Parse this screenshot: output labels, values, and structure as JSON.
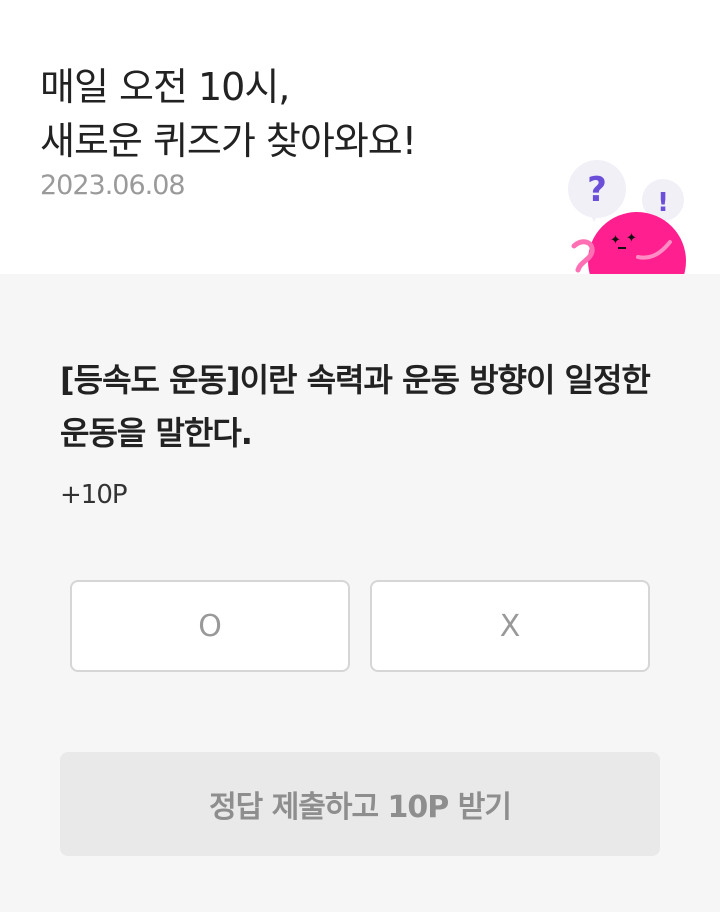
{
  "header": {
    "title_line1": "매일 오전 10시,",
    "title_line2": "새로운 퀴즈가 찾아와요!",
    "date": "2023.06.08"
  },
  "mascot": {
    "question_mark": "?",
    "exclamation_mark": "!",
    "body_color": "#ff1f8e",
    "bubble_color": "#f1f0f7"
  },
  "quiz": {
    "question": "[등속도 운동]이란 속력과 운동 방향이 일정한 운동을 말한다.",
    "points": "+10P",
    "option_o": "O",
    "option_x": "X"
  },
  "submit": {
    "label": "정답 제출하고 10P 받기"
  },
  "colors": {
    "panel_bg": "#f6f6f6",
    "submit_bg": "#e9e9e9",
    "accent_pink": "#ff1f8e",
    "accent_purple": "#6b4fd8"
  }
}
